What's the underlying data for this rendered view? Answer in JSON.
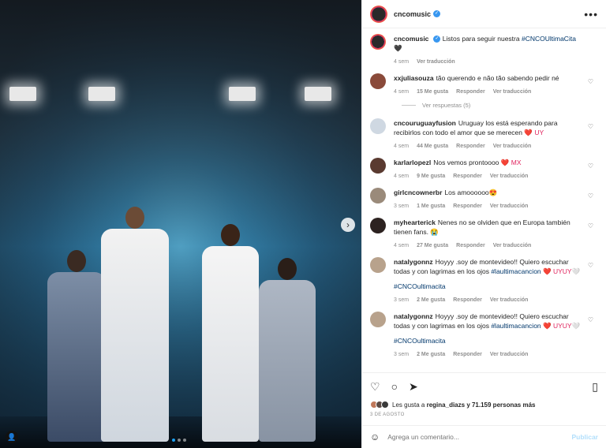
{
  "post": {
    "username": "cncomusic",
    "more_icon": "ellipsis-icon"
  },
  "caption": {
    "username": "cncomusic",
    "text": "Listos para seguir nuestra",
    "hashtag": "#CNCOUltimaCita",
    "emoji": "🖤",
    "time": "4 sem",
    "translate": "Ver traducción"
  },
  "comments": [
    {
      "user": "xxjuliasouza",
      "text": "tão querendo e não tão sabendo pedir né",
      "time": "4 sem",
      "likes": "15 Me gusta",
      "reply": "Responder",
      "translate": "Ver traducción"
    },
    {
      "user": "cncouruguayfusion",
      "text": "Uruguay los está esperando para recibirlos con todo el amor que se merecen",
      "suffix": "❤️ UY",
      "time": "4 sem",
      "likes": "44 Me gusta",
      "reply": "Responder",
      "translate": "Ver traducción"
    },
    {
      "user": "karlarlopezl",
      "text": "Nos vemos prontoooo",
      "suffix": "❤️ MX",
      "time": "4 sem",
      "likes": "9 Me gusta",
      "reply": "Responder",
      "translate": "Ver traducción"
    },
    {
      "user": "girlcncownerbr",
      "text": "Los amoooooo",
      "suffix": "😍",
      "time": "3 sem",
      "likes": "1 Me gusta",
      "reply": "Responder",
      "translate": "Ver traducción"
    },
    {
      "user": "myhearterick",
      "text": "Nenes no se olviden que en Europa también tienen fans.",
      "suffix": "😭",
      "time": "4 sem",
      "likes": "27 Me gusta",
      "reply": "Responder",
      "translate": "Ver traducción"
    },
    {
      "user": "natalygonnz",
      "text": "Hoyyy .soy de montevideo!! Quiero escuchar todas y con lagrimas en los ojos",
      "hashtag": "#laultimacancion",
      "suffix": "❤️ UYUY🤍",
      "hashtag2": "#CNCOultimacita",
      "time": "3 sem",
      "likes": "2 Me gusta",
      "reply": "Responder",
      "translate": "Ver traducción"
    },
    {
      "user": "natalygonnz",
      "text": "Hoyyy .soy de montevideo!! Quiero escuchar todas y con lagrimas en los ojos",
      "hashtag": "#laultimacancion",
      "suffix": "❤️ UYUY🤍",
      "hashtag2": "#CNCOultimacita",
      "time": "3 sem",
      "likes": "2 Me gusta",
      "reply": "Responder",
      "translate": "Ver traducción"
    }
  ],
  "replies_link": "Ver respuestas (5)",
  "likes": {
    "prefix": "Les gusta a",
    "user": "regina_diazs",
    "rest": "y 71.159 personas más"
  },
  "date": "3 DE AGOSTO",
  "add_comment": {
    "placeholder": "Agrega un comentario...",
    "publish": "Publicar"
  }
}
